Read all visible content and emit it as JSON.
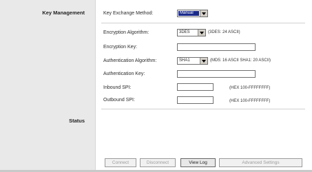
{
  "sections": {
    "key_management": "Key Management",
    "status": "Status"
  },
  "fields": {
    "key_exchange_method": {
      "label": "Key Exchange Method:",
      "value": "Manual"
    },
    "encryption_algorithm": {
      "label": "Encryption Algorithm:",
      "value": "3DES",
      "hint": "(3DES: 24 ASCII)"
    },
    "encryption_key": {
      "label": "Encryption Key:",
      "value": ""
    },
    "authentication_algorithm": {
      "label": "Authentication Algorithm:",
      "value": "SHA1",
      "hint": "(MD5: 16 ASCII SHA1: 20 ASCII)"
    },
    "authentication_key": {
      "label": "Authentication Key:",
      "value": ""
    },
    "inbound_spi": {
      "label": "Inbound SPI:",
      "value": "",
      "hint": "(HEX 100-FFFFFFFF)"
    },
    "outbound_spi": {
      "label": "Outbound SPI:",
      "value": "",
      "hint": "(HEX 100-FFFFFFFF)"
    }
  },
  "buttons": {
    "connect": "Connect",
    "disconnect": "Disconnect",
    "view_log": "View Log",
    "advanced_settings": "Advanced Settings"
  },
  "icons": {
    "dropdown": "chevron-down-icon"
  },
  "colors": {
    "sidebar": "#e9e9e9",
    "selected_highlight": "#1a2a8a"
  }
}
